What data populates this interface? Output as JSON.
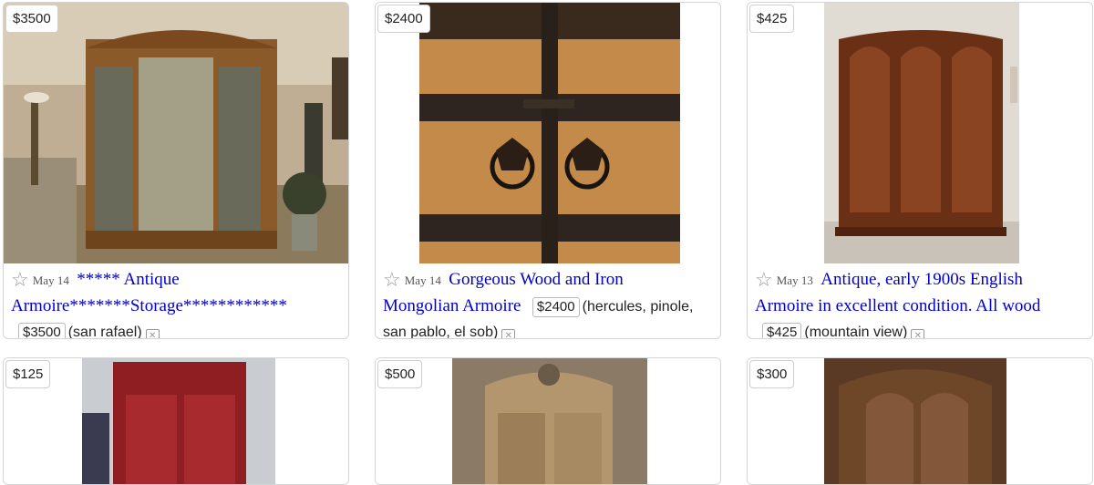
{
  "listings": [
    {
      "price": "$3500",
      "date": "May 14",
      "title_line1": "***** Antique",
      "title_line2": "Armoire*******Storage************",
      "location": "(san rafael)",
      "star_icon": "star-icon",
      "hide_icon": "trash-icon"
    },
    {
      "price": "$2400",
      "date": "May 14",
      "title_line1": "Gorgeous Wood and Iron",
      "title_line2": "Mongolian Armoire",
      "location_line1": "(hercules, pinole,",
      "location_line2": "san pablo, el sob)",
      "star_icon": "star-icon",
      "hide_icon": "trash-icon"
    },
    {
      "price": "$425",
      "date": "May 13",
      "title_line1": "Antique, early 1900s English",
      "title_line2": "Armoire in excellent condition. All wood",
      "location": "(mountain view)",
      "star_icon": "star-icon",
      "hide_icon": "trash-icon"
    },
    {
      "price": "$125"
    },
    {
      "price": "$500"
    },
    {
      "price": "$300"
    }
  ],
  "colors": {
    "link": "#0000cc",
    "border": "#d4d4d4"
  }
}
